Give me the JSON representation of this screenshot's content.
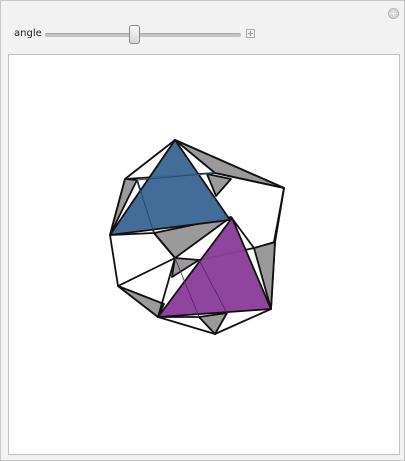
{
  "controls": {
    "angle_label": "angle",
    "angle_value": 0.46
  },
  "scene": {
    "colors": {
      "blue_face": "#3d6895",
      "purple_face": "#8b3f9a",
      "gray_face": "#9a9a9a",
      "edge": "#111111"
    }
  }
}
